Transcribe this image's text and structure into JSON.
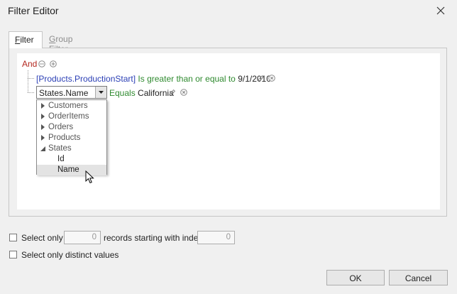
{
  "window": {
    "title": "Filter Editor",
    "close_icon": "close-icon"
  },
  "tabs": [
    {
      "label_first": "F",
      "label_rest": "ilter",
      "active": true
    },
    {
      "label_first": "G",
      "label_rest": "roup Filter",
      "active": false
    }
  ],
  "filter": {
    "group_operator": "And",
    "conditions": [
      {
        "field": "[Products.ProductionStart]",
        "operator": "Is greater than or equal to",
        "value": "9/1/2010"
      },
      {
        "field": "States.Name",
        "operator": "Equals",
        "value": "California"
      }
    ]
  },
  "field_dropdown": {
    "items": [
      {
        "label": "Customers",
        "state": "collapsed"
      },
      {
        "label": "OrderItems",
        "state": "collapsed"
      },
      {
        "label": "Orders",
        "state": "collapsed"
      },
      {
        "label": "Products",
        "state": "collapsed"
      },
      {
        "label": "States",
        "state": "expanded"
      },
      {
        "label": "Id",
        "state": "child"
      },
      {
        "label": "Name",
        "state": "child-hover"
      }
    ]
  },
  "options": {
    "select_only_label": "Select only",
    "select_only_count": "0",
    "records_label": "records starting with index",
    "start_index": "0",
    "distinct_label": "Select only distinct values",
    "select_only_checked": false,
    "distinct_checked": false
  },
  "buttons": {
    "ok": "OK",
    "cancel": "Cancel"
  },
  "colors": {
    "group_operator": "#b3271f",
    "field": "#2b3fb5",
    "operator": "#2f8a2f"
  }
}
